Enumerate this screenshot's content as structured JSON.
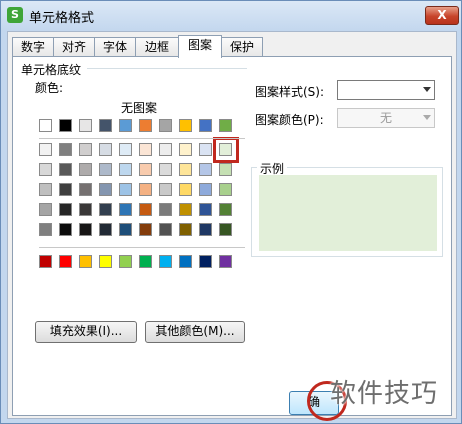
{
  "window": {
    "title": "单元格格式",
    "app_icon": "S",
    "close_label": "X"
  },
  "tabs": [
    {
      "label": "数字",
      "active": false
    },
    {
      "label": "对齐",
      "active": false
    },
    {
      "label": "字体",
      "active": false
    },
    {
      "label": "边框",
      "active": false
    },
    {
      "label": "图案",
      "active": true
    },
    {
      "label": "保护",
      "active": false
    }
  ],
  "shading": {
    "group_label": "单元格底纹",
    "color_label": "颜色:",
    "no_pattern": "无图案",
    "palette_rows": [
      [
        "#ffffff",
        "#000000",
        "#e7e6e6",
        "#44546a",
        "#5b9bd5",
        "#ed7d31",
        "#a5a5a5",
        "#ffc000",
        "#4472c4",
        "#70ad47"
      ],
      [
        "#f2f2f2",
        "#7f7f7f",
        "#d0cece",
        "#d6dce4",
        "#deebf6",
        "#fbe5d5",
        "#ededed",
        "#fff2cc",
        "#dae3f3",
        "#e2efd9"
      ],
      [
        "#d8d8d8",
        "#595959",
        "#aeabab",
        "#adb9ca",
        "#bdd7ee",
        "#f8cbad",
        "#dbdbdb",
        "#fee599",
        "#b4c6e7",
        "#c5e0b3"
      ],
      [
        "#bfbfbf",
        "#3f3f3f",
        "#757070",
        "#8496b0",
        "#9dc3e6",
        "#f4b183",
        "#c9c9c9",
        "#ffd965",
        "#8eaadb",
        "#a8d08d"
      ],
      [
        "#a5a5a5",
        "#262626",
        "#3a3838",
        "#323f4f",
        "#2e75b5",
        "#c55a11",
        "#7b7b7b",
        "#bf9000",
        "#2f5496",
        "#538135"
      ],
      [
        "#7f7f7f",
        "#0c0c0c",
        "#171616",
        "#222a35",
        "#1e4e79",
        "#833c0b",
        "#525252",
        "#7f6000",
        "#1f3864",
        "#375623"
      ]
    ],
    "standard_colors": [
      "#c00000",
      "#ff0000",
      "#ffc000",
      "#ffff00",
      "#92d050",
      "#00b050",
      "#00b0f0",
      "#0070c0",
      "#002060",
      "#7030a0"
    ],
    "selected_color": "#e2efd9",
    "fill_effects_button": "填充效果(I)...",
    "more_colors_button": "其他颜色(M)..."
  },
  "pattern": {
    "style_label": "图案样式(S):",
    "style_value": "",
    "color_label": "图案颜色(P):",
    "color_value": "无"
  },
  "sample": {
    "label": "示例",
    "fill": "#e2efd9"
  },
  "footer": {
    "ok_label": "确"
  },
  "watermark": "软件技巧"
}
